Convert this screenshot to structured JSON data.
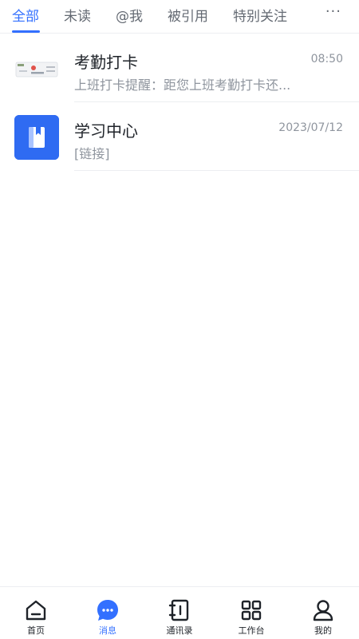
{
  "tabs": [
    {
      "label": "全部",
      "active": true
    },
    {
      "label": "未读",
      "active": false
    },
    {
      "label": "@我",
      "active": false
    },
    {
      "label": "被引用",
      "active": false
    },
    {
      "label": "特别关注",
      "active": false
    }
  ],
  "more_label": "···",
  "messages": [
    {
      "title": "考勤打卡",
      "time": "08:50",
      "preview": "上班打卡提醒：距您上班考勤打卡还...",
      "avatar_icon": "attendance-card-icon"
    },
    {
      "title": "学习中心",
      "time": "2023/07/12",
      "preview": "[链接]",
      "avatar_icon": "book-icon"
    }
  ],
  "nav": [
    {
      "label": "首页",
      "icon": "home-icon",
      "active": false
    },
    {
      "label": "消息",
      "icon": "message-icon",
      "active": true
    },
    {
      "label": "通讯录",
      "icon": "contacts-icon",
      "active": false
    },
    {
      "label": "工作台",
      "icon": "apps-grid-icon",
      "active": false
    },
    {
      "label": "我的",
      "icon": "profile-icon",
      "active": false
    }
  ],
  "colors": {
    "accent": "#3370ff",
    "text": "#1f2329",
    "secondary": "#8f959e"
  }
}
